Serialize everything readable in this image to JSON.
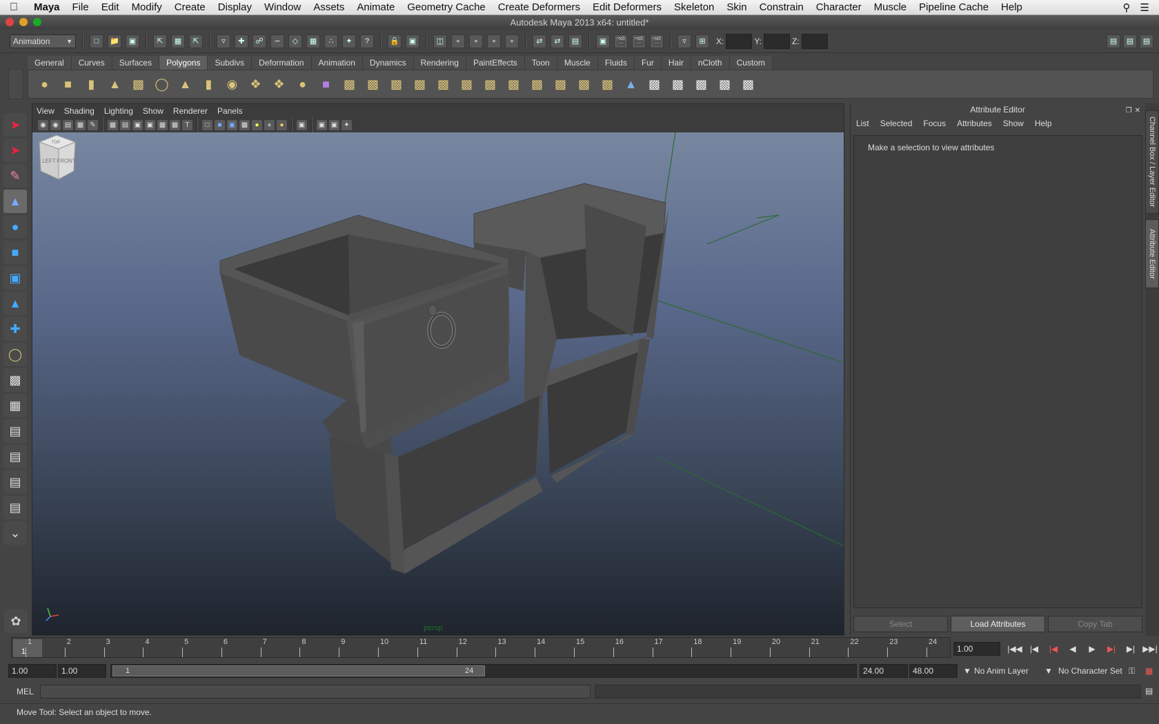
{
  "menubar": {
    "app": "Maya",
    "items": [
      "File",
      "Edit",
      "Modify",
      "Create",
      "Display",
      "Window",
      "Assets",
      "Animate",
      "Geometry Cache",
      "Create Deformers",
      "Edit Deformers",
      "Skeleton",
      "Skin",
      "Constrain",
      "Character",
      "Muscle",
      "Pipeline Cache",
      "Help"
    ]
  },
  "window": {
    "title": "Autodesk Maya 2013 x64: untitled*"
  },
  "statusline": {
    "mode": "Animation",
    "x_label": "X:",
    "y_label": "Y:",
    "z_label": "Z:"
  },
  "shelf": {
    "tabs": [
      "General",
      "Curves",
      "Surfaces",
      "Polygons",
      "Subdivs",
      "Deformation",
      "Animation",
      "Dynamics",
      "Rendering",
      "PaintEffects",
      "Toon",
      "Muscle",
      "Fluids",
      "Fur",
      "Hair",
      "nCloth",
      "Custom"
    ],
    "active_tab": "Polygons"
  },
  "panel": {
    "menu": [
      "View",
      "Shading",
      "Lighting",
      "Show",
      "Renderer",
      "Panels"
    ],
    "camera": "persp",
    "viewcube": {
      "top": "TOP",
      "left": "LEFT",
      "front": "FRONT"
    }
  },
  "attribute_editor": {
    "title": "Attribute Editor",
    "menu": [
      "List",
      "Selected",
      "Focus",
      "Attributes",
      "Show",
      "Help"
    ],
    "message": "Make a selection to view attributes",
    "buttons": {
      "select": "Select",
      "load": "Load Attributes",
      "copy": "Copy Tab"
    }
  },
  "side_tabs": {
    "channel_box": "Channel Box / Layer Editor",
    "attribute_editor": "Attribute Editor"
  },
  "timeline": {
    "ticks": [
      "1",
      "2",
      "3",
      "4",
      "5",
      "6",
      "7",
      "8",
      "9",
      "10",
      "11",
      "12",
      "13",
      "14",
      "15",
      "16",
      "17",
      "18",
      "19",
      "20",
      "21",
      "22",
      "23",
      "24"
    ],
    "current_frame": "1",
    "frame_field": "1.00"
  },
  "range": {
    "start_time": "1.00",
    "playback_start": "1.00",
    "range_start": "1",
    "range_end": "24",
    "playback_end": "24.00",
    "end_time": "48.00",
    "anim_layer": "No Anim Layer",
    "character_set": "No Character Set"
  },
  "mel": {
    "label": "MEL"
  },
  "help_line": "Move Tool: Select an object to move.",
  "colors": {
    "viewport_top": "#7787a0",
    "viewport_bottom": "#1f242d",
    "grid_green": "#1f6e2a"
  }
}
